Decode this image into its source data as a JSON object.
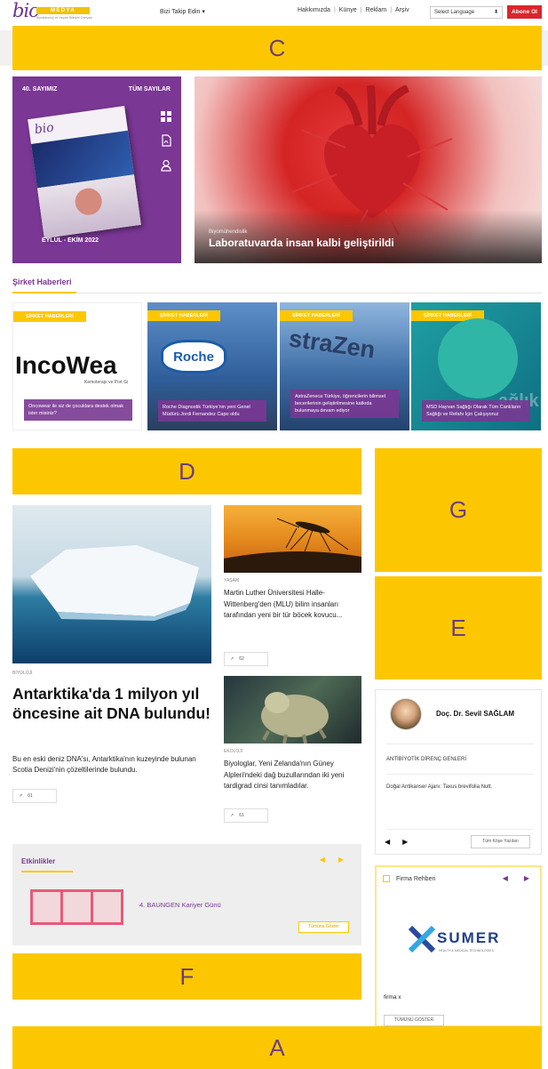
{
  "header": {
    "logo_main": "bio",
    "logo_badge": "MEDYA",
    "logo_tagline": "Biyoteknoloji ve Yaşam Bilimleri Dünyası",
    "follow_label": "Bizi Takip Edin",
    "nav": [
      "Hakkımızda",
      "Künye",
      "Reklam",
      "Arşiv"
    ],
    "language_select": "Select Language",
    "subscribe_label": "Abone Ol"
  },
  "placeholders": {
    "c": "C",
    "d": "D",
    "g": "G",
    "e": "E",
    "f": "F",
    "a": "A"
  },
  "magazine": {
    "issue": "40. SAYIMIZ",
    "all_issues": "TÜM SAYILAR",
    "date": "EYLÜL - EKİM 2022",
    "cover_logo": "bio"
  },
  "hero": {
    "category": "Biyomühendislik",
    "title": "Laboratuvarda insan kalbi geliştirildi"
  },
  "company_news": {
    "title": "Şirket Haberleri",
    "cards": [
      {
        "tag": "ŞİRKET HABERLERİ",
        "logo": "IncoWea",
        "logo_sub": "Kemoterapi ve Port Gi",
        "caption": "Oncowear ile siz de çocuklara destek olmak ister misiniz?"
      },
      {
        "tag": "ŞİRKET HABERLERİ",
        "logo": "Roche",
        "caption": "Roche Diagnostik Türkiye'nin yeni Genel Müdürü Jordi Fernandez Capo oldu"
      },
      {
        "tag": "ŞİRKET HABERLERİ",
        "logo": "straZen",
        "caption": "AstraZeneca Türkiye, öğrencilerin bilimsel becerilerinin geliştirilmesine katkıda bulunmaya devam ediyor"
      },
      {
        "tag": "ŞİRKET HABERLERİ",
        "logo": "ağlık",
        "caption": "MSD Hayvan Sağlığı Olarak Tüm Canlıların Sağlığı ve Refahı İçin Çalışıyoruz"
      }
    ]
  },
  "articles": {
    "main": {
      "category": "BİYOLOJİ",
      "title": "Antarktika'da 1 milyon yıl öncesine ait DNA bulundu!",
      "description": "Bu en eski deniz DNA'sı, Antarktika'nın kuzeyinde bulunan Scotia Denizi'nin çözeltilerinde bulundu.",
      "shares": "61"
    },
    "side1": {
      "category": "YAŞAM",
      "title": "Martin Luther Üniversitesi Halle-Wittenberg'den (MLU) bilim insanları tarafından yeni bir tür böcek kovucu...",
      "shares": "62"
    },
    "side2": {
      "category": "EKOLOJİ",
      "title": "Biyologlar, Yeni Zelanda'nın Güney Alpleri'ndeki dağ buzullarından iki yeni tardigrad cinsi tanımladılar.",
      "shares": "61"
    }
  },
  "events": {
    "title": "Etkinlikler",
    "item": "4. BAUNGEN Kariyer Günü",
    "all_label": "Tümünü Göster"
  },
  "author": {
    "name": "Doç. Dr. Sevil SAĞLAM",
    "topic": "ANTİBİYOTİK DİRENÇ GENLERİ",
    "article": "Doğal Antikanser Ajanı: Taxus brevifolia Nutt.",
    "all_label": "Tüm Köşe Yazıları"
  },
  "firm_directory": {
    "title": "Firma Rehberi",
    "logo": "SUMER",
    "logo_sub": "HEALTH & MEDICAL TECHNOLOGIES",
    "firm_name": "firma x",
    "button": "TÜMÜNÜ GÖSTER"
  },
  "colors": {
    "brand_purple": "#7a3794",
    "placeholder_yellow": "#fdc700",
    "subscribe_red": "#d9262c"
  }
}
